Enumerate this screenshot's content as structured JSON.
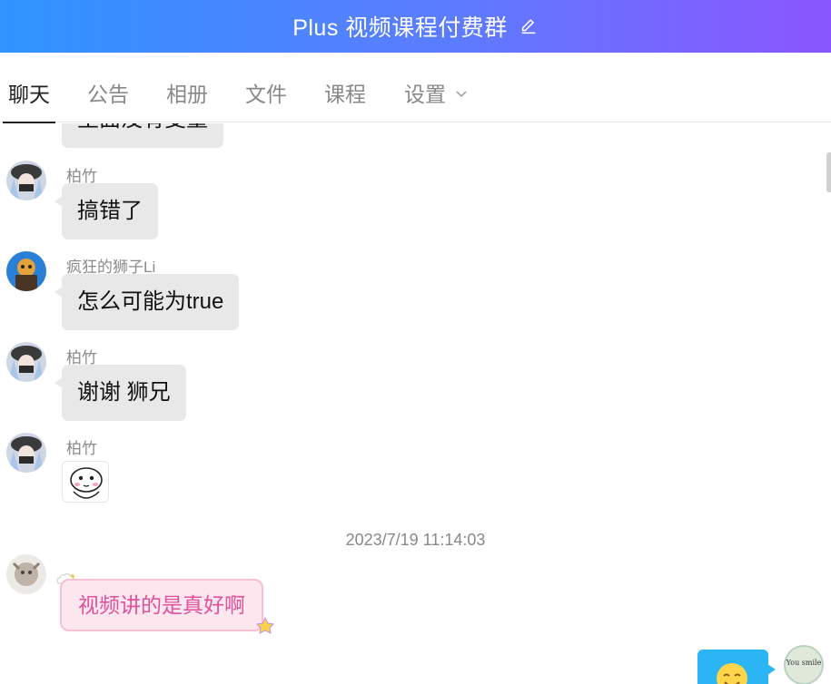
{
  "header": {
    "title": "Plus 视频课程付费群",
    "edit_icon": "pencil-icon"
  },
  "tabs": [
    {
      "label": "聊天",
      "active": true
    },
    {
      "label": "公告",
      "active": false
    },
    {
      "label": "相册",
      "active": false
    },
    {
      "label": "文件",
      "active": false
    },
    {
      "label": "课程",
      "active": false
    },
    {
      "label": "设置",
      "active": false,
      "has_dropdown": true
    }
  ],
  "messages": [
    {
      "sender": "",
      "text": "里面没有变量",
      "partially_visible": true
    },
    {
      "sender": "柏竹",
      "text": "搞错了"
    },
    {
      "sender": "疯狂的狮子Li",
      "text": "怎么可能为true"
    },
    {
      "sender": "柏竹",
      "text": "谢谢 狮兄"
    },
    {
      "sender": "柏竹",
      "text": "",
      "type": "sticker"
    }
  ],
  "timestamp": "2023/7/19 11:14:03",
  "later_messages": [
    {
      "sender": "",
      "text": "视频讲的是真好啊",
      "style": "pink-decorated"
    }
  ],
  "own_avatar_text": "You smile",
  "colors": {
    "header_start": "#2f95ff",
    "header_end": "#8a56ff",
    "bubble": "#e8e8e8",
    "pink_text": "#e0529b",
    "mine_bubble": "#2bb5f5"
  }
}
